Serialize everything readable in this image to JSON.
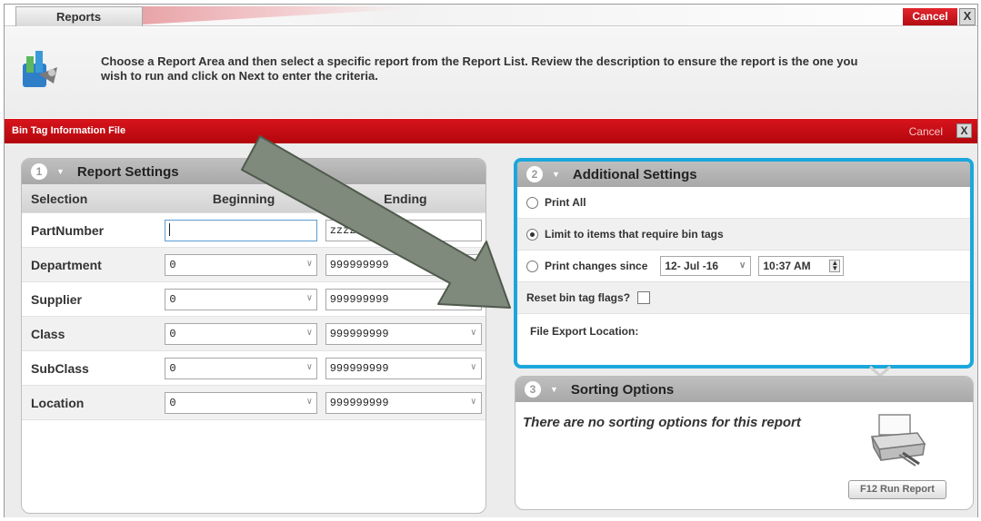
{
  "top_bar": {
    "tab_label": "Reports",
    "cancel_label": "Cancel",
    "close_label": "X",
    "instruction_line1": "Choose a Report Area and then select a specific report from the Report List. Review the description to ensure the report is the one you",
    "instruction_line2": "wish to run and click on Next to enter the criteria."
  },
  "dialog": {
    "title": "Bin Tag Information File",
    "cancel_label": "Cancel",
    "close_label": "X"
  },
  "report_settings": {
    "step": "1",
    "title": "Report Settings",
    "headers": {
      "selection": "Selection",
      "beginning": "Beginning",
      "ending": "Ending"
    },
    "rows": [
      {
        "label": "PartNumber",
        "beginning": "",
        "ending": "zzzzzz"
      },
      {
        "label": "Department",
        "beginning": "0",
        "ending": "999999999"
      },
      {
        "label": "Supplier",
        "beginning": "0",
        "ending": "999999999"
      },
      {
        "label": "Class",
        "beginning": "0",
        "ending": "999999999"
      },
      {
        "label": "SubClass",
        "beginning": "0",
        "ending": "999999999"
      },
      {
        "label": "Location",
        "beginning": "0",
        "ending": "999999999"
      }
    ]
  },
  "additional_settings": {
    "step": "2",
    "title": "Additional Settings",
    "print_all": "Print All",
    "limit": "Limit to items that require bin tags",
    "print_changes": "Print changes since",
    "date_value": "12- Jul -16",
    "time_value": "10:37 AM",
    "reset_flags": "Reset bin tag flags?",
    "file_export": "File Export Location:",
    "selected_option": "limit"
  },
  "sorting_options": {
    "step": "3",
    "title": "Sorting Options",
    "message": "There are no sorting options for this report",
    "run_button": "F12 Run Report"
  },
  "colors": {
    "brand_red": "#c40c14",
    "highlight_blue": "#1ba7dc",
    "arrow_gray": "#7f8a7c"
  }
}
